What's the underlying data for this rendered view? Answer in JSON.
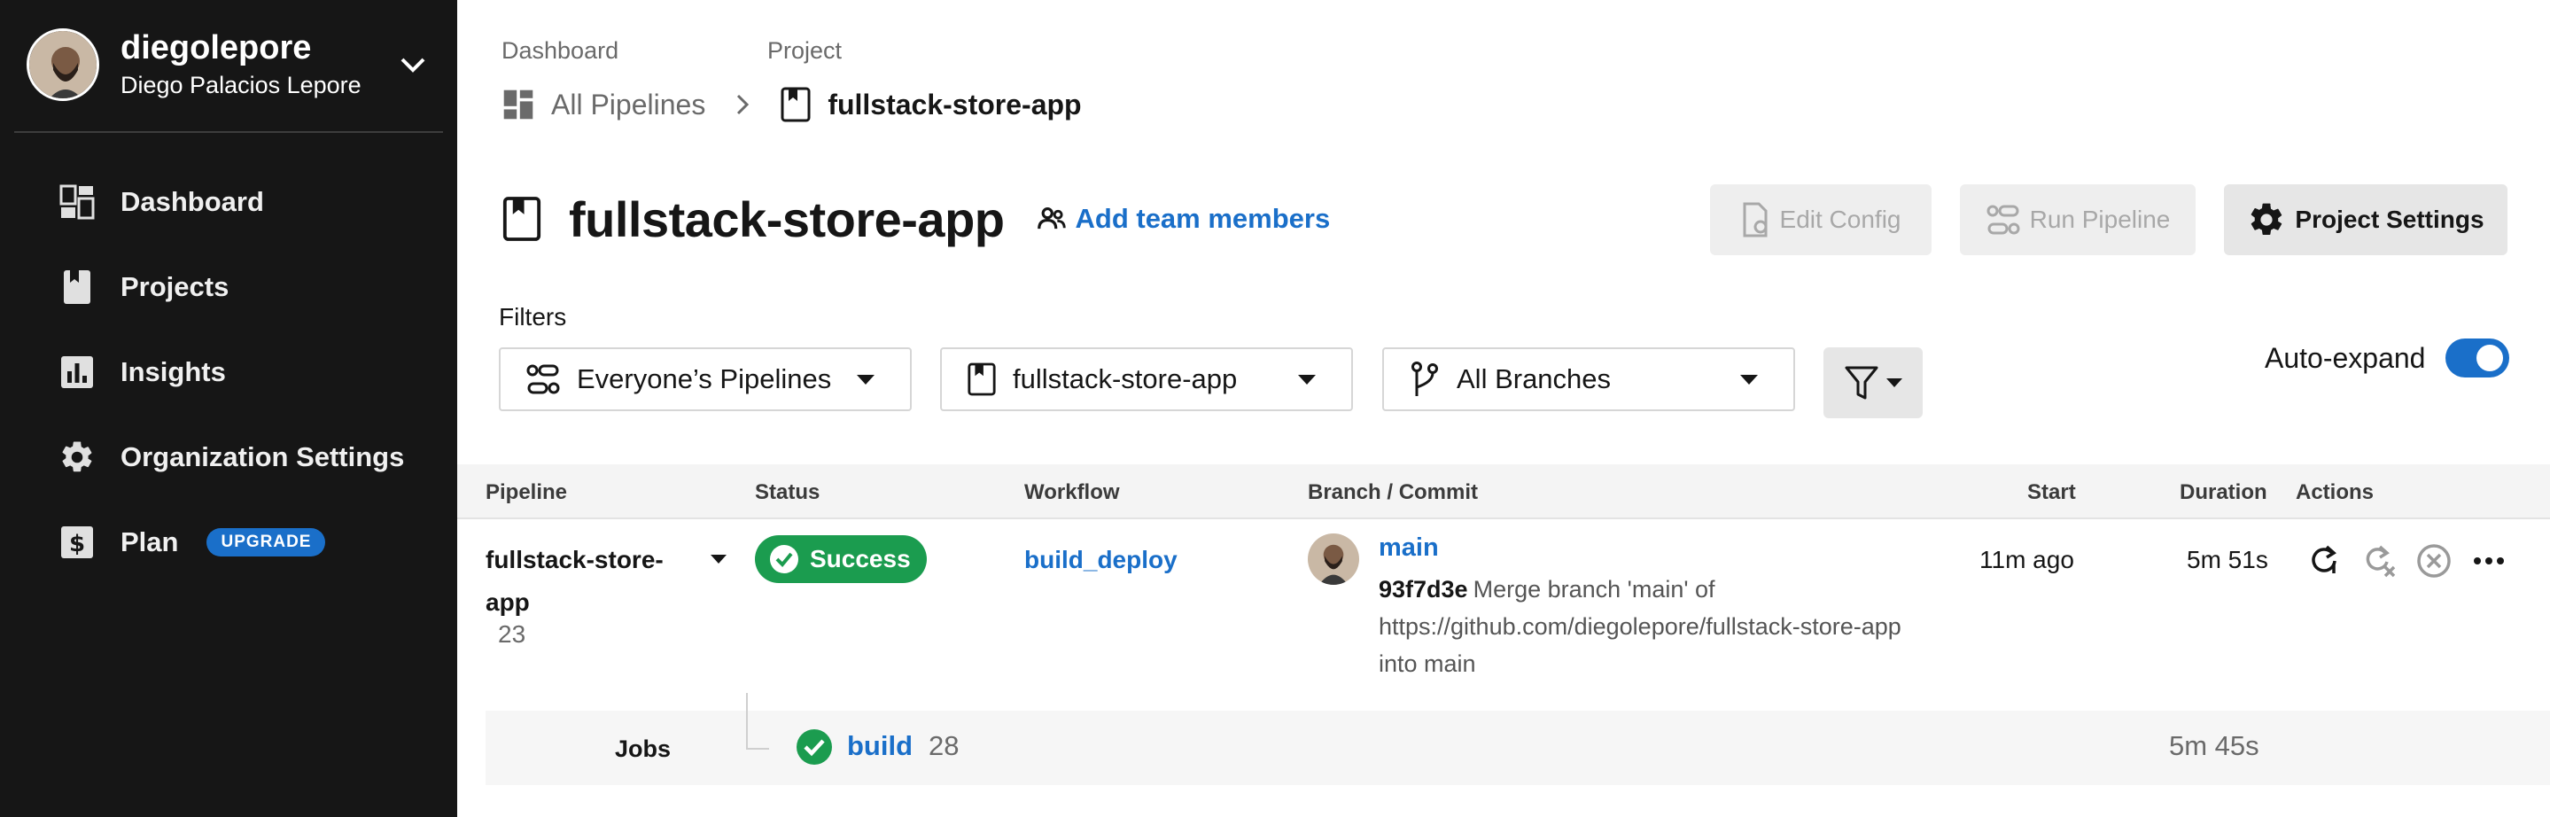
{
  "colors": {
    "sidebar_bg": "#161616",
    "accent": "#1a6fc9",
    "success": "#1b9c4f"
  },
  "user": {
    "username": "diegolepore",
    "full_name": "Diego Palacios Lepore"
  },
  "sidebar": {
    "items": [
      {
        "label": "Dashboard",
        "icon": "dashboard-icon"
      },
      {
        "label": "Projects",
        "icon": "project-book-icon"
      },
      {
        "label": "Insights",
        "icon": "insights-chart-icon"
      },
      {
        "label": "Organization Settings",
        "icon": "gear-icon"
      },
      {
        "label": "Plan",
        "icon": "dollar-icon",
        "badge": "UPGRADE"
      }
    ]
  },
  "breadcrumb": {
    "label_dashboard": "Dashboard",
    "label_project": "Project",
    "all_pipelines": "All Pipelines",
    "project_name": "fullstack-store-app"
  },
  "header": {
    "title": "fullstack-store-app",
    "add_team": "Add team members",
    "edit_config": "Edit Config",
    "run_pipeline": "Run Pipeline",
    "project_settings": "Project Settings"
  },
  "filters": {
    "label": "Filters",
    "pipelines": "Everyone’s Pipelines",
    "project": "fullstack-store-app",
    "branches": "All Branches",
    "auto_expand": "Auto-expand",
    "auto_expand_on": true
  },
  "table": {
    "headers": [
      "Pipeline",
      "Status",
      "Workflow",
      "Branch / Commit",
      "Start",
      "Duration",
      "Actions"
    ],
    "rows": [
      {
        "pipeline": "fullstack-store-app",
        "number": "23",
        "status": "Success",
        "workflow": "build_deploy",
        "branch": "main",
        "commit_sha": "93f7d3e",
        "commit_message": "Merge branch 'main' of https://github.com/diegolepore/fullstack-store-app into main",
        "start": "11m ago",
        "duration": "5m 51s",
        "jobs": {
          "label": "Jobs",
          "items": [
            {
              "name": "build",
              "number": "28",
              "duration": "5m 45s"
            }
          ]
        }
      }
    ]
  }
}
